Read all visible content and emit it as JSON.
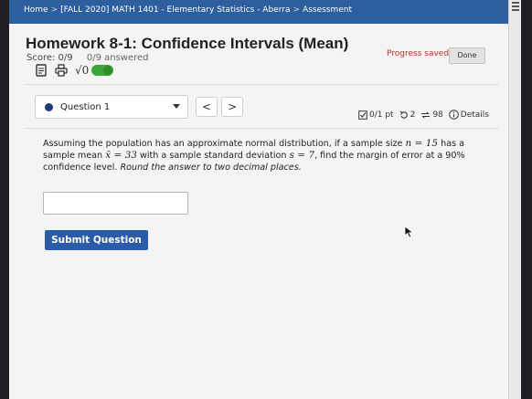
{
  "breadcrumb": {
    "items": [
      "Home",
      "[FALL 2020] MATH 1401 - Elementary Statistics - Aberra",
      "Assessment"
    ],
    "separator": ">"
  },
  "header": {
    "title": "Homework 8-1: Confidence Intervals (Mean)",
    "score": "Score: 0/9",
    "answered": "0/9 answered",
    "progress_status": "Progress saved",
    "done_label": "Done"
  },
  "tools": {
    "icons": [
      "notes-icon",
      "print-icon",
      "sqrt-icon",
      "toggle-switch"
    ],
    "sqrt_label": "√0"
  },
  "question_nav": {
    "selected": "Question 1",
    "prev_label": "<",
    "next_label": ">",
    "points": "0/1 pt",
    "attempts": "2",
    "retries": "98",
    "details_label": "Details"
  },
  "question": {
    "part1": "Assuming the population has an approximate normal distribution, if a sample size ",
    "n_expr": "n = 15",
    "part2": " has a sample mean ",
    "mean_expr": "x̄ = 33",
    "part3": " with a sample standard deviation ",
    "s_expr": "s = 7",
    "part4": ", find the margin of error at a 90% confidence level. ",
    "instruction": "Round the answer to two decimal places."
  },
  "answer": {
    "value": ""
  },
  "submit_label": "Submit Question",
  "colors": {
    "topbar": "#2d5e9e",
    "submit": "#2b5ca8",
    "progress_saved": "#b03030",
    "toggle": "#3ea33a",
    "question_dot": "#213a7a"
  }
}
